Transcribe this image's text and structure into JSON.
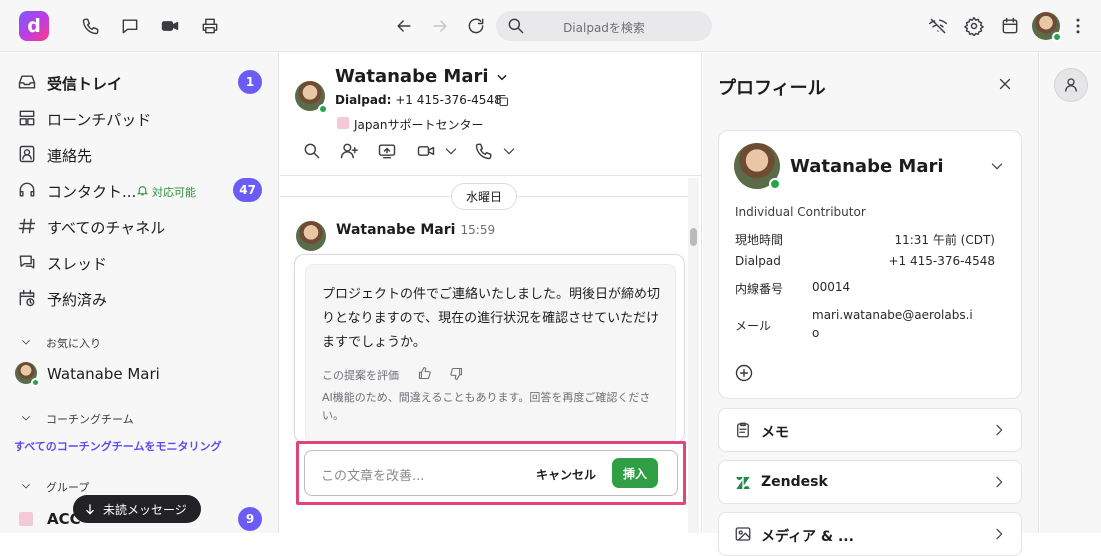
{
  "topbar": {
    "logo_letter": "d",
    "search_placeholder": "Dialpadを検索"
  },
  "sidebar": {
    "items": [
      {
        "label": "受信トレイ",
        "icon": "inbox-icon",
        "badge": "1"
      },
      {
        "label": "ローンチパッド",
        "icon": "launchpad-icon"
      },
      {
        "label": "連絡先",
        "icon": "contacts-icon"
      },
      {
        "label": "コンタクト...",
        "icon": "headset-icon",
        "status": "対応可能",
        "badge": "47"
      },
      {
        "label": "すべてのチャネル",
        "icon": "hash-icon"
      },
      {
        "label": "スレッド",
        "icon": "threads-icon"
      },
      {
        "label": "予約済み",
        "icon": "calendar-clock-icon"
      }
    ],
    "favorites_title": "お気に入り",
    "favorite_contact": "Watanabe Mari",
    "coaching_title": "コーチングチーム",
    "coaching_link": "すべてのコーチングチームをモニタリング",
    "group_title": "グループ",
    "group_item": "ACC",
    "group_badge": "9",
    "unread_pill": "未読メッセージ"
  },
  "conversation": {
    "name": "Watanabe Mari",
    "number_label": "Dialpad:",
    "number": "+1 415-376-4548",
    "team": "Japanサポートセンター",
    "day_chip": "水曜日",
    "message_sender": "Watanabe Mari",
    "message_time": "15:59",
    "ai_text": "プロジェクトの件でご連絡いたしました。明後日が締め切りとなりますので、現在の進行状況を確認させていただけますでしょうか。",
    "rate_label": "この提案を評価",
    "disclaimer": "AI機能のため、間違えることもあります。回答を再度ご確認ください。",
    "improve_placeholder": "この文章を改善...",
    "cancel_label": "キャンセル",
    "insert_label": "挿入"
  },
  "profile": {
    "title": "プロフィール",
    "name": "Watanabe Mari",
    "role": "Individual Contributor",
    "local_time_label": "現地時間",
    "local_time": "11:31 午前 (CDT)",
    "dialpad_label": "Dialpad",
    "dialpad_number": "+1 415-376-4548",
    "extension_label": "内線番号",
    "extension": "00014",
    "email_label": "メール",
    "email_line1": "mari.watanabe@aerolabs.i",
    "email_line2": "o",
    "sections": [
      "メモ",
      "Zendesk",
      "メディア & ..."
    ]
  },
  "colors": {
    "accent": "#6b5cf6",
    "online": "#27a348",
    "insert_button": "#2f9e44",
    "highlight": "#e0447a"
  }
}
